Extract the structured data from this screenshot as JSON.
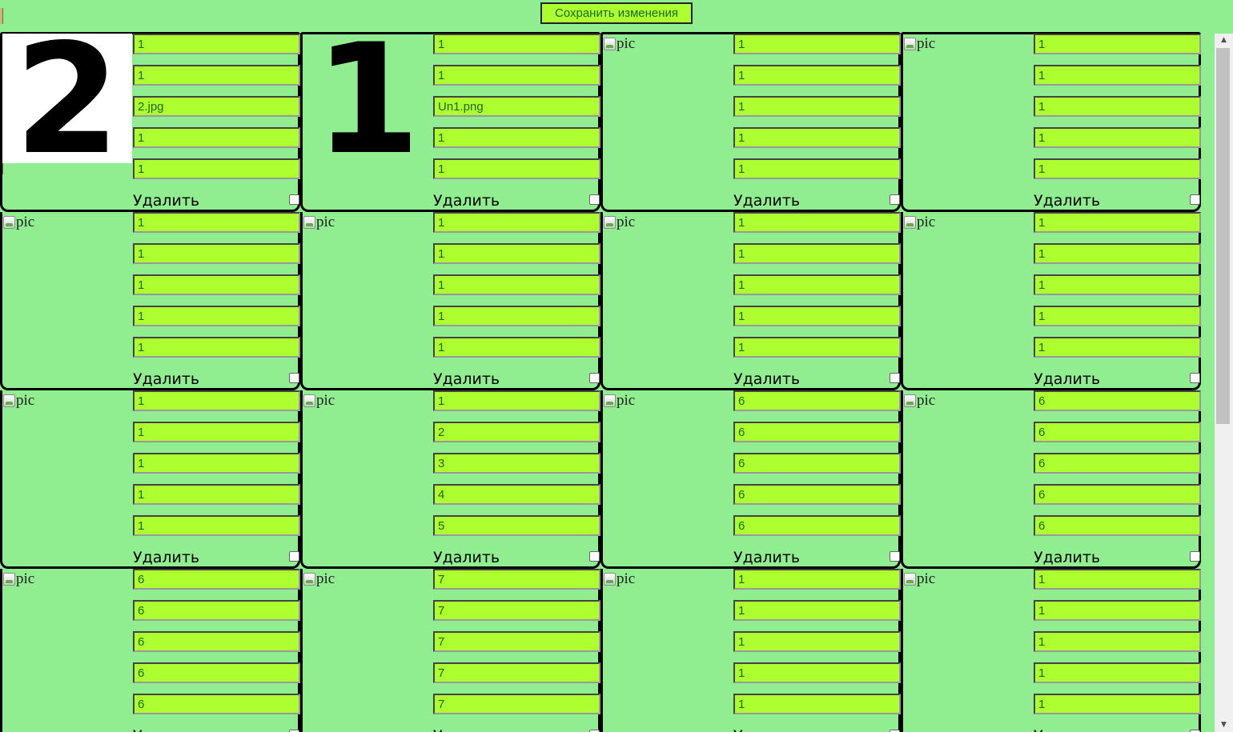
{
  "toolbar": {
    "save_label": "Сохранить изменения"
  },
  "common": {
    "delete_label": "Удалить",
    "broken_image_alt": "pic"
  },
  "scrollbar": {
    "up_arrow": "▲",
    "down_arrow": "▼"
  },
  "cards": [
    {
      "preview": "2",
      "values": [
        "1",
        "1",
        "2.jpg",
        "1",
        "1"
      ]
    },
    {
      "preview": "1",
      "values": [
        "1",
        "1",
        "Un1.png",
        "1",
        "1"
      ]
    },
    {
      "preview": "",
      "values": [
        "1",
        "1",
        "1",
        "1",
        "1"
      ]
    },
    {
      "preview": "",
      "values": [
        "1",
        "1",
        "1",
        "1",
        "1"
      ]
    },
    {
      "preview": "",
      "values": [
        "1",
        "1",
        "1",
        "1",
        "1"
      ]
    },
    {
      "preview": "",
      "values": [
        "1",
        "1",
        "1",
        "1",
        "1"
      ]
    },
    {
      "preview": "",
      "values": [
        "1",
        "1",
        "1",
        "1",
        "1"
      ]
    },
    {
      "preview": "",
      "values": [
        "1",
        "1",
        "1",
        "1",
        "1"
      ]
    },
    {
      "preview": "",
      "values": [
        "1",
        "1",
        "1",
        "1",
        "1"
      ]
    },
    {
      "preview": "",
      "values": [
        "1",
        "2",
        "3",
        "4",
        "5"
      ]
    },
    {
      "preview": "",
      "values": [
        "6",
        "6",
        "6",
        "6",
        "6"
      ]
    },
    {
      "preview": "",
      "values": [
        "6",
        "6",
        "6",
        "6",
        "6"
      ]
    },
    {
      "preview": "",
      "values": [
        "6",
        "6",
        "6",
        "6",
        "6"
      ]
    },
    {
      "preview": "",
      "values": [
        "7",
        "7",
        "7",
        "7",
        "7"
      ]
    },
    {
      "preview": "",
      "values": [
        "1",
        "1",
        "1",
        "1",
        "1"
      ]
    },
    {
      "preview": "",
      "values": [
        "1",
        "1",
        "1",
        "1",
        "1"
      ]
    }
  ]
}
